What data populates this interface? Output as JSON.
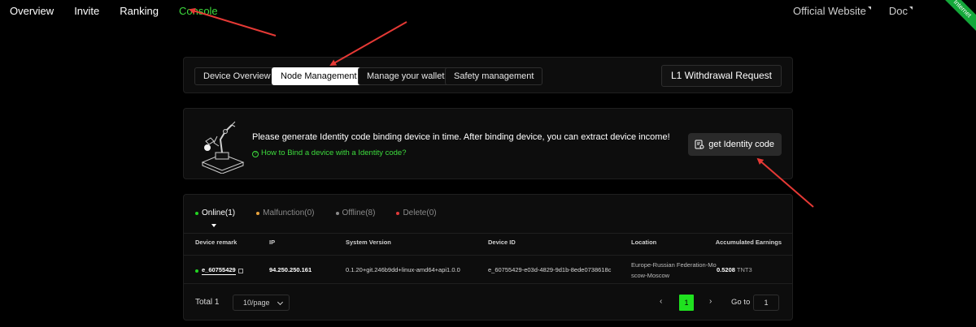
{
  "topnav": {
    "items": [
      {
        "label": "Overview",
        "active": false
      },
      {
        "label": "Invite",
        "active": false
      },
      {
        "label": "Ranking",
        "active": false
      },
      {
        "label": "Console",
        "active": true
      }
    ],
    "right": [
      {
        "label": "Official Website"
      },
      {
        "label": "Doc"
      }
    ],
    "ribbon": "Internet"
  },
  "tabs": {
    "items": [
      {
        "label": "Device Overview"
      },
      {
        "label": "Node Management"
      },
      {
        "label": "Manage your wallet"
      },
      {
        "label": "Safety management"
      }
    ],
    "active_index": 1,
    "withdraw_label": "L1 Withdrawal Request"
  },
  "info": {
    "message": "Please generate Identity code binding device in time. After binding device, you can extract device income!",
    "help_link": "How to Bind a device with a Identity code?",
    "identity_button": "get Identity code"
  },
  "device_table": {
    "status_tabs": [
      {
        "label": "Online(1)",
        "color": "#22d322"
      },
      {
        "label": "Malfunction(0)",
        "color": "#e8a33d"
      },
      {
        "label": "Offline(8)",
        "color": "#8a8a8a"
      },
      {
        "label": "Delete(0)",
        "color": "#e03a3a"
      }
    ],
    "columns": {
      "remark": "Device remark",
      "ip": "IP",
      "version": "System Version",
      "device_id": "Device ID",
      "location": "Location",
      "earnings": "Accumulated Earnings"
    },
    "rows": [
      {
        "remark": "e_60755429",
        "ip": "94.250.250.161",
        "version": "0.1.20+git.246b9dd+linux-amd64+api1.0.0",
        "device_id": "e_60755429-e03d-4829-9d1b-8ede0738618c",
        "location_line1": "Europe-Russian Federation-Mo",
        "location_line2": "scow-Moscow",
        "earnings_value": "0.5208",
        "earnings_unit": "TNT3"
      }
    ]
  },
  "pagination": {
    "total": "Total 1",
    "page_size": "10/page",
    "prev": "‹",
    "current": "1",
    "next": "›",
    "goto_label": "Go to",
    "goto_value": "1"
  },
  "colors": {
    "accent_green": "#3ddc3d",
    "annotation_red": "#e53935"
  }
}
